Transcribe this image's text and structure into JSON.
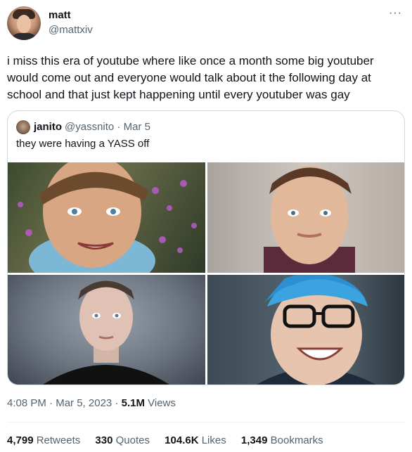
{
  "author": {
    "display_name": "matt",
    "handle": "@mattxiv"
  },
  "more_icon": "more-horizontal-icon",
  "tweet": {
    "text": "i miss this era of youtube where like once a month some big youtuber would come out and everyone would talk about it the following day at school and that just kept happening until every youtuber was gay"
  },
  "quote": {
    "display_name": "janito",
    "handle_date": "@yassnito · Mar 5",
    "text": "they were having a YASS off"
  },
  "meta": {
    "time": "4:08 PM",
    "sep1": "·",
    "date": "Mar 5, 2023",
    "sep2": "·",
    "views_count": "5.1M",
    "views_label": "Views"
  },
  "stats": {
    "retweets_count": "4,799",
    "retweets_label": "Retweets",
    "quotes_count": "330",
    "quotes_label": "Quotes",
    "likes_count": "104.6K",
    "likes_label": "Likes",
    "bookmarks_count": "1,349",
    "bookmarks_label": "Bookmarks"
  },
  "colors": {
    "text": "#0f1419",
    "secondary": "#536471",
    "border": "#cfd9de"
  }
}
